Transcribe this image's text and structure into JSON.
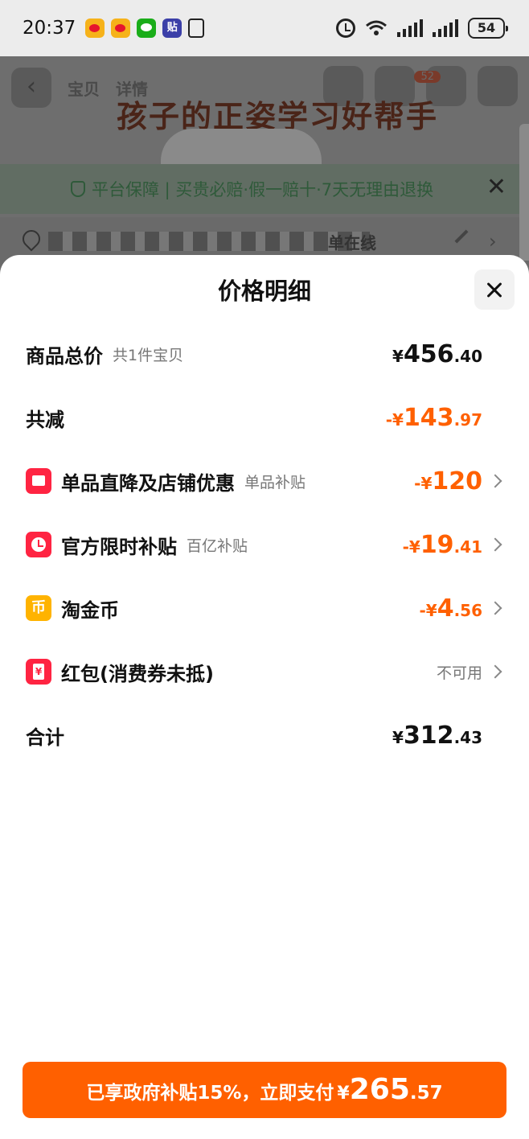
{
  "status_bar": {
    "time": "20:37",
    "app_icons": [
      "weibo-icon",
      "weibo-icon",
      "wechat-icon",
      "tie-icon",
      "nfc-icon"
    ],
    "tie_glyph": "贴",
    "battery": "54"
  },
  "background": {
    "tab_1": "宝贝",
    "tab_2": "详情",
    "cart_badge": "52",
    "more_badge": "···",
    "headline": "孩子的正姿学习好帮手",
    "guarantee": "平台保障 | 买贵必赔·假一赔十·7天无理由退换",
    "address_tail": "单在线"
  },
  "sheet": {
    "title": "价格明细",
    "rows": {
      "total_price": {
        "label": "商品总价",
        "sub": "共1件宝贝",
        "currency": "¥",
        "int": "456",
        "dec": ".40"
      },
      "discount": {
        "label": "共减",
        "currency": "-¥",
        "int": "143",
        "dec": ".97"
      },
      "shop": {
        "label": "单品直降及店铺优惠",
        "sub": "单品补贴",
        "currency": "-¥",
        "int": "120",
        "dec": ""
      },
      "official": {
        "label": "官方限时补贴",
        "sub": "百亿补贴",
        "currency": "-¥",
        "int": "19",
        "dec": ".41"
      },
      "coin": {
        "label": "淘金币",
        "icon_glyph": "币",
        "currency": "-¥",
        "int": "4",
        "dec": ".56"
      },
      "red_packet": {
        "label": "红包(消费券未抵)",
        "status": "不可用"
      },
      "sum": {
        "label": "合计",
        "currency": "¥",
        "int": "312",
        "dec": ".43"
      }
    },
    "pay_button": {
      "label": "已享政府补贴15%，立即支付",
      "currency": "¥",
      "int": "265",
      "dec": ".57"
    }
  },
  "colors": {
    "accent": "#ff6000",
    "red": "#ff2442",
    "coin": "#ffb300"
  }
}
